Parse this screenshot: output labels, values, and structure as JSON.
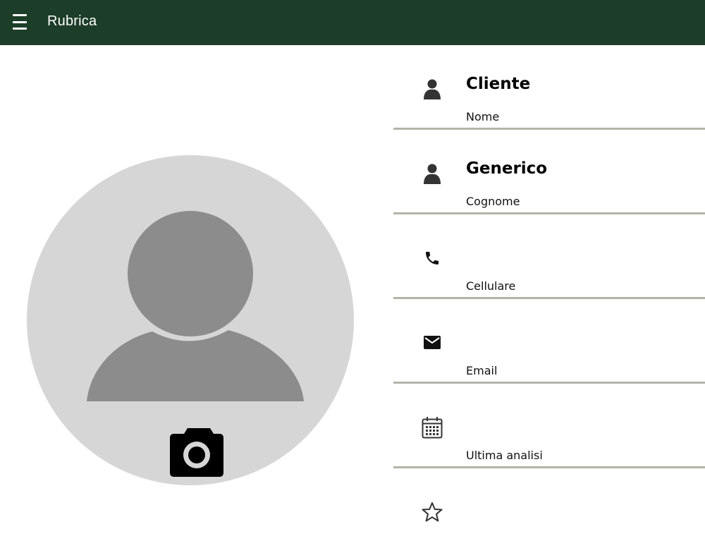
{
  "app": {
    "title": "Rubrica"
  },
  "colors": {
    "toolbar": "#1c3d28",
    "avatar_bg": "#d6d6d6",
    "avatar_fg": "#8c8c8c",
    "divider": "#b3b4a9"
  },
  "icons": {
    "menu": "hamburger-menu-icon",
    "camera": "camera-icon",
    "person": "person-icon",
    "phone": "phone-icon",
    "email": "email-icon",
    "calendar": "calendar-icon",
    "star": "star-outline-icon"
  },
  "fields": {
    "nome": {
      "value": "Cliente",
      "label": "Nome"
    },
    "cognome": {
      "value": "Generico",
      "label": "Cognome"
    },
    "cellulare": {
      "value": "",
      "label": "Cellulare"
    },
    "email": {
      "value": "",
      "label": "Email"
    },
    "ultima_analisi": {
      "value": "",
      "label": "Ultima analisi"
    }
  }
}
